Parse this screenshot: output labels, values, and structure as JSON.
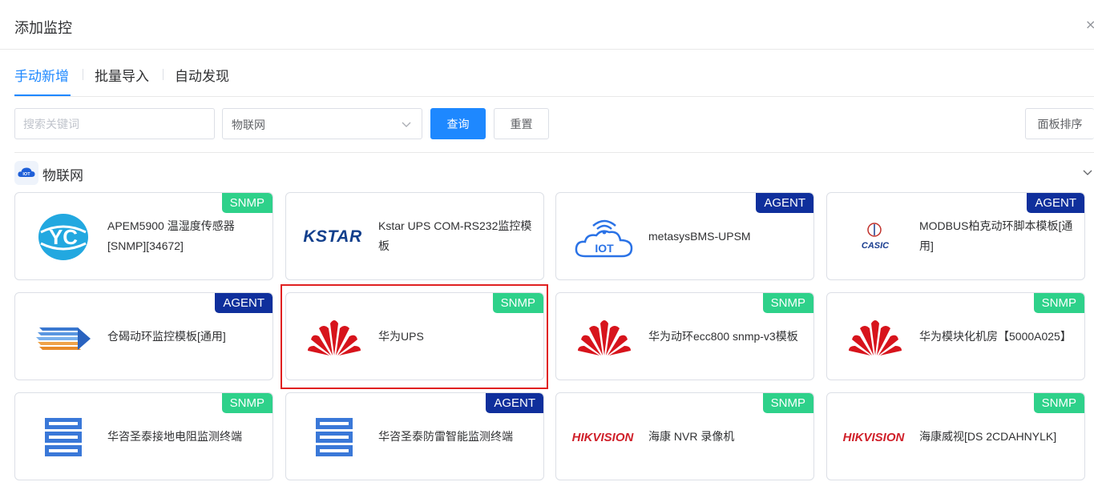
{
  "dialog": {
    "title": "添加监控",
    "close": "×"
  },
  "tabs": [
    {
      "label": "手动新增",
      "active": true
    },
    {
      "label": "批量导入",
      "active": false
    },
    {
      "label": "自动发现",
      "active": false
    }
  ],
  "toolbar": {
    "search_placeholder": "搜索关键词",
    "category_value": "物联网",
    "query_label": "查询",
    "reset_label": "重置",
    "sort_label": "面板排序"
  },
  "section": {
    "title": "物联网",
    "icon_text": "IOT"
  },
  "cards": [
    {
      "label": "APEM5900 温湿度传感器[SNMP][34672]",
      "badge": "SNMP",
      "logo": "yc"
    },
    {
      "label": "Kstar UPS COM-RS232监控模板",
      "badge": "",
      "logo": "kstar",
      "logo_text": "KSTAR"
    },
    {
      "label": "metasysBMS-UPSM",
      "badge": "AGENT",
      "logo": "iot-cloud",
      "logo_text": "IOT"
    },
    {
      "label": "MODBUS柏克动环脚本模板[通用]",
      "badge": "AGENT",
      "logo": "casic",
      "logo_text": "CASIC"
    },
    {
      "label": "仓碣动环监控模板[通用]",
      "badge": "AGENT",
      "logo": "stripes"
    },
    {
      "label": "华为UPS",
      "badge": "SNMP",
      "logo": "huawei",
      "selected": true
    },
    {
      "label": "华为动环ecc800 snmp-v3模板",
      "badge": "SNMP",
      "logo": "huawei"
    },
    {
      "label": "华为模块化机房【5000A025】",
      "badge": "SNMP",
      "logo": "huawei"
    },
    {
      "label": "华咨圣泰接地电阻监测终端",
      "badge": "SNMP",
      "logo": "server"
    },
    {
      "label": "华咨圣泰防雷智能监测终端",
      "badge": "AGENT",
      "logo": "server"
    },
    {
      "label": "海康 NVR 录像机",
      "badge": "SNMP",
      "logo": "hikvision",
      "logo_text": "HIKVISION"
    },
    {
      "label": "海康威视[DS 2CDAHNYLK]",
      "badge": "SNMP",
      "logo": "hikvision",
      "logo_text": "HIKVISION"
    }
  ],
  "colors": {
    "primary": "#1e88ff",
    "snmp_badge": "#2ed18a",
    "agent_badge": "#0f2f9c",
    "selected_outline": "#e02020",
    "huawei_red": "#d7141c",
    "kstar_blue": "#123f8c",
    "hikvision_red": "#d0202a"
  }
}
